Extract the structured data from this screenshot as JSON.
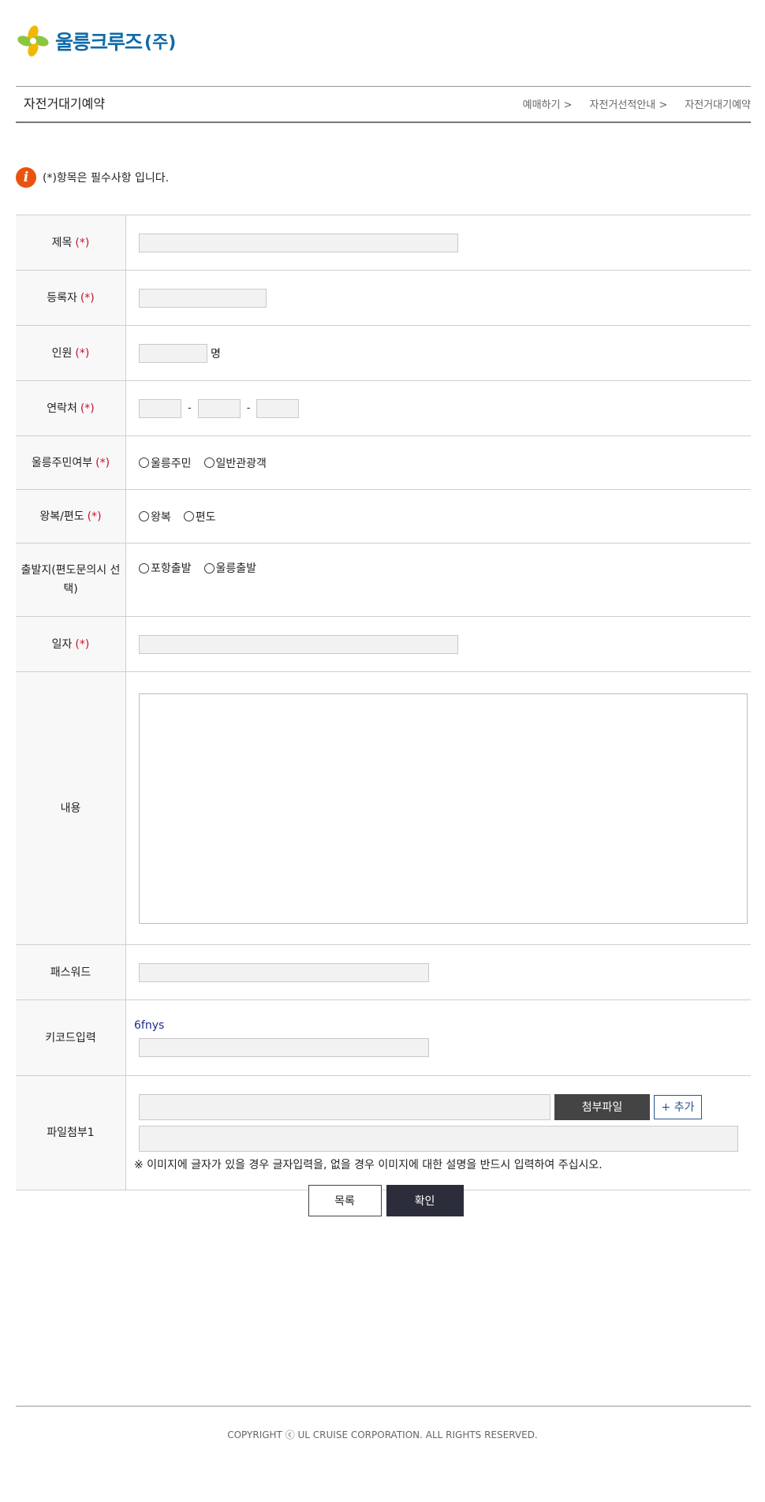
{
  "header": {
    "logo_text": "울릉크루즈",
    "logo_corp": "(주)",
    "page_title": "자전거대기예약",
    "breadcrumb": [
      "예매하기 >",
      "자전거선적안내 >",
      "자전거대기예약"
    ]
  },
  "notice": "(*)항목은 필수사항 입니다.",
  "required_mark": "(*)",
  "form": {
    "title_label": "제목",
    "registrant_label": "등록자",
    "people_label": "인원",
    "people_unit": "명",
    "contact_label": "연락처",
    "contact_separator": "-",
    "resident_label": "울릉주민여부",
    "resident_options": [
      "울릉주민",
      "일반관광객"
    ],
    "trip_label": "왕복/편도",
    "trip_options": [
      "왕복",
      "편도"
    ],
    "departure_label": "출발지(편도문의시 선택)",
    "departure_options": [
      "포항출발",
      "울릉출발"
    ],
    "date_label": "일자",
    "content_label": "내용",
    "password_label": "패스워드",
    "keycode_label": "키코드입력",
    "keycode_value": "6fnys",
    "file_label": "파일첨부1",
    "attach_button": "첨부파일",
    "add_button": "+ 추가",
    "file_note": "※ 이미지에 글자가 있을 경우 글자입력을, 없을 경우 이미지에 대한 설명을 반드시 입력하여 주십시오."
  },
  "actions": {
    "list_button": "목록",
    "confirm_button": "확인"
  },
  "footer": "COPYRIGHT ⓒ UL CRUISE CORPORATION. ALL RIGHTS RESERVED.",
  "colors": {
    "brand_blue": "#0f6aa8",
    "required_red": "#c8102e",
    "info_orange": "#e8540f",
    "confirm_dark": "#2b2d3a"
  }
}
